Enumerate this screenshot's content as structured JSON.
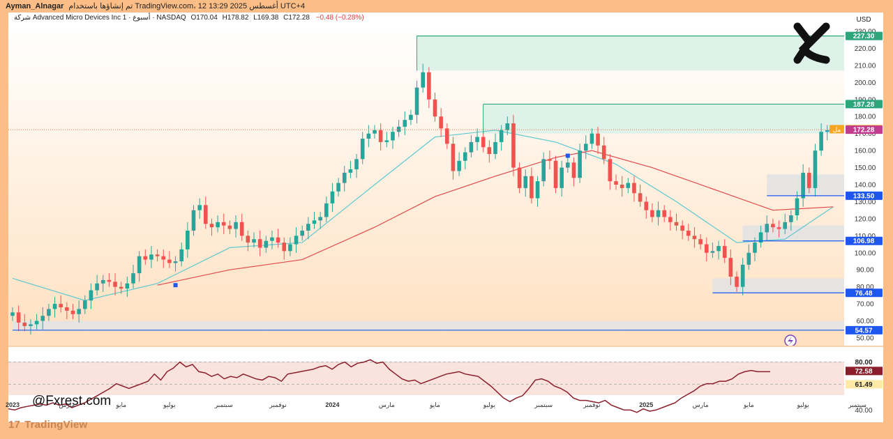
{
  "header": {
    "author": "Ayman_Alnagar",
    "published": "تم إنشاؤها باستخدام TradingView.com، 12 أغسطس 2025 13:29 UTC+4",
    "prefix": "شركة",
    "symbol": "Advanced Micro Devices Inc",
    "interval": "1 · أسبوع",
    "exchange": "NASDAQ",
    "open": "O170.04",
    "high": "H178.82",
    "low": "L169.38",
    "close": "C172.28",
    "change": "−0.48 (−0.28%)"
  },
  "currency": "USD",
  "watermark": "@Fxrest.com",
  "brand": "TradingView",
  "brand_mark": "17",
  "colors": {
    "bull": "#26a69a",
    "bear": "#ef5350",
    "ema_fast": "#5ec8d0",
    "ema_slow": "#e0494a",
    "level_line": "#1e56f0",
    "zone_green": "#dff2ea",
    "zone_grey": "#e6e3e3",
    "rsi_line": "#8a1e2a"
  },
  "chart_data": {
    "type": "candlestick",
    "symbol": "AMD",
    "timeframe": "1W",
    "ylim": [
      50,
      230
    ],
    "y_ticks": [
      50,
      60,
      70,
      80,
      90,
      100,
      110,
      120,
      130,
      140,
      150,
      160,
      170,
      180,
      190,
      200,
      210,
      220,
      230
    ],
    "x_ticks": [
      {
        "label": "2023",
        "bold": true,
        "w": 0
      },
      {
        "label": "مارس",
        "w": 9
      },
      {
        "label": "مايو",
        "w": 18
      },
      {
        "label": "يوليو",
        "w": 26
      },
      {
        "label": "سبتمبر",
        "w": 35
      },
      {
        "label": "نوفمبر",
        "w": 44
      },
      {
        "label": "2024",
        "bold": true,
        "w": 53
      },
      {
        "label": "مارس",
        "w": 62
      },
      {
        "label": "مايو",
        "w": 70
      },
      {
        "label": "يوليو",
        "w": 79
      },
      {
        "label": "سبتمبر",
        "w": 88
      },
      {
        "label": "نوفمبر",
        "w": 96
      },
      {
        "label": "2025",
        "bold": true,
        "w": 105
      },
      {
        "label": "مارس",
        "w": 114
      },
      {
        "label": "مايو",
        "w": 122
      },
      {
        "label": "يوليو",
        "w": 131
      },
      {
        "label": "سبتمبر",
        "w": 140
      }
    ],
    "closes": [
      65,
      59,
      57,
      58,
      60,
      63,
      67,
      70,
      68,
      66,
      64,
      67,
      72,
      78,
      82,
      84,
      83,
      80,
      79,
      82,
      88,
      98,
      96,
      99,
      98,
      96,
      94,
      95,
      102,
      113,
      125,
      128,
      117,
      115,
      118,
      116,
      114,
      118,
      110,
      106,
      108,
      103,
      107,
      109,
      106,
      101,
      105,
      110,
      113,
      117,
      119,
      121,
      129,
      136,
      141,
      147,
      149,
      155,
      167,
      170,
      172,
      165,
      166,
      171,
      174,
      178,
      181,
      197,
      206,
      190,
      180,
      173,
      164,
      148,
      154,
      159,
      165,
      168,
      162,
      158,
      165,
      172,
      176,
      150,
      138,
      145,
      132,
      142,
      155,
      154,
      138,
      150,
      153,
      144,
      160,
      164,
      170,
      163,
      155,
      142,
      140,
      138,
      141,
      135,
      130,
      125,
      121,
      125,
      121,
      118,
      116,
      113,
      110,
      108,
      105,
      100,
      101,
      104,
      97,
      86,
      80,
      93,
      100,
      106,
      112,
      117,
      115,
      114,
      118,
      122,
      132,
      147,
      138,
      160,
      171,
      172
    ],
    "overlays": {
      "ema_fast": [
        [
          0,
          85
        ],
        [
          12,
          72
        ],
        [
          24,
          82
        ],
        [
          36,
          103
        ],
        [
          48,
          106
        ],
        [
          60,
          140
        ],
        [
          70,
          168
        ],
        [
          80,
          172
        ],
        [
          90,
          165
        ],
        [
          100,
          152
        ],
        [
          110,
          130
        ],
        [
          120,
          106
        ],
        [
          128,
          108
        ],
        [
          136,
          127
        ]
      ],
      "ema_slow": [
        [
          24,
          81
        ],
        [
          36,
          90
        ],
        [
          48,
          96
        ],
        [
          60,
          115
        ],
        [
          70,
          133
        ],
        [
          80,
          145
        ],
        [
          90,
          156
        ],
        [
          96,
          160
        ],
        [
          106,
          150
        ],
        [
          118,
          135
        ],
        [
          126,
          125
        ],
        [
          136,
          127
        ]
      ]
    },
    "zones": [
      {
        "from_w": 67,
        "y1": 207,
        "y2": 227.3,
        "color": "green"
      },
      {
        "from_w": 78,
        "y1": 170,
        "y2": 187.28,
        "color": "green"
      },
      {
        "from_w": 125,
        "y1": 133.5,
        "y2": 146,
        "color": "grey"
      },
      {
        "from_w": 121,
        "y1": 107,
        "y2": 116,
        "color": "grey"
      },
      {
        "from_w": 116,
        "y1": 76.5,
        "y2": 85,
        "color": "grey"
      },
      {
        "from_w": 0,
        "y1": 54.6,
        "y2": 60,
        "color": "grey"
      }
    ],
    "levels": [
      {
        "label": "227.30",
        "value": 227.3,
        "color": "#2ea67c",
        "from_w": 67
      },
      {
        "label": "187.28",
        "value": 187.28,
        "color": "#2ea67c",
        "from_w": 78
      },
      {
        "label": "133.50",
        "value": 133.5,
        "color": "#1e56f0",
        "from_w": 125
      },
      {
        "label": "106.98",
        "value": 106.98,
        "color": "#1e56f0",
        "from_w": 121
      },
      {
        "label": "76.48",
        "value": 76.48,
        "color": "#1e56f0",
        "from_w": 116
      },
      {
        "label": "54.57",
        "value": 54.57,
        "color": "#1e56f0",
        "from_w": 0
      }
    ],
    "price_tags": [
      {
        "label": "172.59",
        "value": 172.59,
        "color": "#f5a623"
      },
      {
        "label": "172.28",
        "value": 172.28,
        "color": "#c33b8e"
      }
    ],
    "last_price_side_tag": "مل",
    "rsi": {
      "values": [
        41,
        40,
        42,
        43,
        44,
        45,
        44,
        46,
        44,
        45,
        42,
        44,
        46,
        49,
        52,
        55,
        58,
        62,
        60,
        58,
        60,
        62,
        64,
        70,
        65,
        72,
        75,
        80,
        76,
        78,
        72,
        71,
        68,
        70,
        66,
        68,
        67,
        70,
        68,
        66,
        65,
        68,
        67,
        64,
        70,
        71,
        72,
        73,
        74,
        76,
        77,
        74,
        78,
        80,
        76,
        79,
        80,
        82,
        79,
        80,
        74,
        70,
        66,
        64,
        65,
        62,
        64,
        66,
        68,
        70,
        71,
        72,
        70,
        69,
        68,
        64,
        60,
        55,
        50,
        47,
        50,
        52,
        58,
        65,
        66,
        64,
        60,
        58,
        55,
        50,
        48,
        48,
        47,
        46,
        48,
        44,
        42,
        40,
        40,
        38,
        41,
        39,
        40,
        42,
        44,
        46,
        50,
        53,
        56,
        60,
        62,
        62,
        64,
        64,
        66,
        70,
        72,
        73,
        72,
        72,
        72
      ],
      "ylim": [
        35,
        85
      ],
      "ticks": [
        {
          "label": "40.00",
          "value": 40
        }
      ],
      "tags": [
        {
          "label": "80.00",
          "value": 80,
          "color": "#ffffff",
          "text": "#222"
        },
        {
          "label": "72.58",
          "value": 72.58,
          "color": "#8a1e2a",
          "text": "#ffffff"
        },
        {
          "label": "61.49",
          "value": 61.49,
          "color": "#ffe9a6",
          "text": "#222"
        }
      ]
    }
  }
}
